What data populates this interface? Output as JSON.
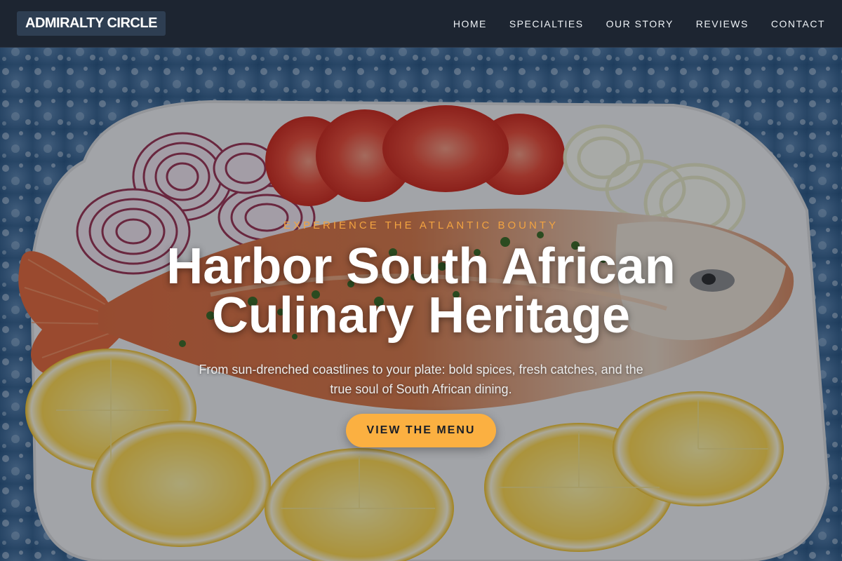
{
  "nav": {
    "logo": "ADMIRALTY CIRCLE",
    "items": [
      {
        "label": "HOME"
      },
      {
        "label": "SPECIALTIES"
      },
      {
        "label": "OUR STORY"
      },
      {
        "label": "REVIEWS"
      },
      {
        "label": "CONTACT"
      }
    ]
  },
  "hero": {
    "eyebrow": "EXPERIENCE THE ATLANTIC BOUNTY",
    "title": "Harbor South African Culinary Heritage",
    "subtitle": "From sun-drenched coastlines to your plate: bold spices, fresh catches, and the true soul of South African dining.",
    "cta_label": "VIEW THE MENU"
  },
  "colors": {
    "nav_bg": "#1d2531",
    "logo_bg": "#2e3e52",
    "accent": "#fbb041",
    "eyebrow": "#f2a341",
    "background_blue": "#2f5a84"
  },
  "icons": [
    "grilled-fish-hero-image"
  ]
}
